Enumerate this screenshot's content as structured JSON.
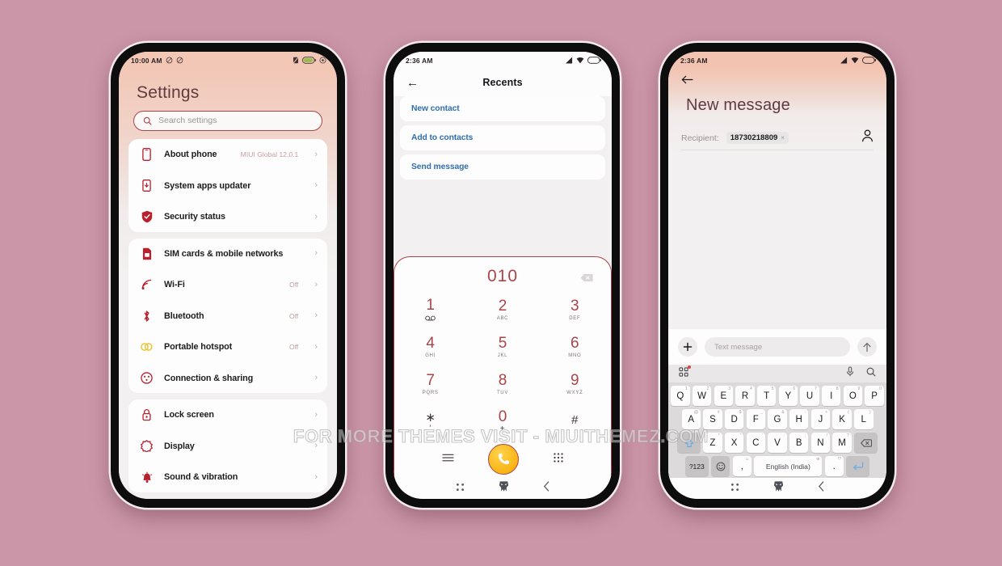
{
  "background_color": "#cb96a8",
  "accent_color": "#a8454b",
  "watermark": "FOR MORE THEMES VISIT - MIUITHEMEZ.COM",
  "phone1": {
    "statusbar": {
      "time": "10:00 AM"
    },
    "title": "Settings",
    "search": {
      "placeholder": "Search settings"
    },
    "groups": [
      {
        "rows": [
          {
            "label": "About phone",
            "value": "MIUI Global 12.0.1",
            "icon": "phone-outline-icon"
          },
          {
            "label": "System apps updater",
            "value": "",
            "icon": "app-update-icon"
          },
          {
            "label": "Security status",
            "value": "",
            "icon": "shield-check-icon"
          }
        ]
      },
      {
        "rows": [
          {
            "label": "SIM cards & mobile networks",
            "value": "",
            "icon": "sim-card-icon"
          },
          {
            "label": "Wi-Fi",
            "value": "Off",
            "icon": "wifi-icon"
          },
          {
            "label": "Bluetooth",
            "value": "Off",
            "icon": "bluetooth-icon"
          },
          {
            "label": "Portable hotspot",
            "value": "Off",
            "icon": "hotspot-icon"
          },
          {
            "label": "Connection & sharing",
            "value": "",
            "icon": "connection-sharing-icon"
          }
        ]
      },
      {
        "rows": [
          {
            "label": "Lock screen",
            "value": "",
            "icon": "lock-icon"
          },
          {
            "label": "Display",
            "value": "",
            "icon": "display-icon"
          },
          {
            "label": "Sound & vibration",
            "value": "",
            "icon": "bell-icon"
          }
        ]
      }
    ]
  },
  "phone2": {
    "statusbar": {
      "time": "2:36 AM"
    },
    "appbar": {
      "title": "Recents",
      "back": "←"
    },
    "options": [
      {
        "label": "New contact"
      },
      {
        "label": "Add to contacts"
      },
      {
        "label": "Send message"
      }
    ],
    "dialer": {
      "number": "010",
      "keys": [
        {
          "digit": "1",
          "sub": "∞",
          "sub_kind": "voicemail"
        },
        {
          "digit": "2",
          "sub": "ABC",
          "sub_kind": "text"
        },
        {
          "digit": "3",
          "sub": "DEF",
          "sub_kind": "text"
        },
        {
          "digit": "4",
          "sub": "GHI",
          "sub_kind": "text"
        },
        {
          "digit": "5",
          "sub": "JKL",
          "sub_kind": "text"
        },
        {
          "digit": "6",
          "sub": "MNO",
          "sub_kind": "text"
        },
        {
          "digit": "7",
          "sub": "PQRS",
          "sub_kind": "text"
        },
        {
          "digit": "8",
          "sub": "TUV",
          "sub_kind": "text"
        },
        {
          "digit": "9",
          "sub": "WXYZ",
          "sub_kind": "text"
        },
        {
          "digit": "∗",
          "sub": "′",
          "sub_kind": "big"
        },
        {
          "digit": "0",
          "sub": "+",
          "sub_kind": "big"
        },
        {
          "digit": "#",
          "sub": "",
          "sub_kind": "text"
        }
      ]
    }
  },
  "phone3": {
    "statusbar": {
      "time": "2:36 AM"
    },
    "title": "New message",
    "recipient": {
      "label": "Recipient:",
      "chip": "18730218809",
      "remove": "×"
    },
    "composer": {
      "placeholder": "Text message"
    },
    "keyboard": {
      "row1": [
        {
          "key": "Q",
          "sup": "1"
        },
        {
          "key": "W",
          "sup": "2"
        },
        {
          "key": "E",
          "sup": "3"
        },
        {
          "key": "R",
          "sup": "4"
        },
        {
          "key": "T",
          "sup": "5"
        },
        {
          "key": "Y",
          "sup": "6"
        },
        {
          "key": "U",
          "sup": "7"
        },
        {
          "key": "I",
          "sup": "8"
        },
        {
          "key": "O",
          "sup": "9"
        },
        {
          "key": "P",
          "sup": "0"
        }
      ],
      "row2": [
        {
          "key": "A",
          "sup": "@"
        },
        {
          "key": "S",
          "sup": "#"
        },
        {
          "key": "D",
          "sup": "$"
        },
        {
          "key": "F",
          "sup": "_"
        },
        {
          "key": "G",
          "sup": "&"
        },
        {
          "key": "H",
          "sup": "-"
        },
        {
          "key": "J",
          "sup": "+"
        },
        {
          "key": "K",
          "sup": "("
        },
        {
          "key": "L",
          "sup": ")"
        }
      ],
      "row3": [
        {
          "key": "Z",
          "sup": "*"
        },
        {
          "key": "X",
          "sup": "\""
        },
        {
          "key": "C",
          "sup": "'"
        },
        {
          "key": "V",
          "sup": ":"
        },
        {
          "key": "B",
          "sup": ";"
        },
        {
          "key": "N",
          "sup": "!"
        },
        {
          "key": "M",
          "sup": "?"
        }
      ],
      "numbers_key": "?123",
      "comma_key": ",",
      "comma_sup": "☺",
      "period_key": ".",
      "period_sup": "!?",
      "space_key": "English (India)",
      "space_sup": "⊕"
    }
  }
}
